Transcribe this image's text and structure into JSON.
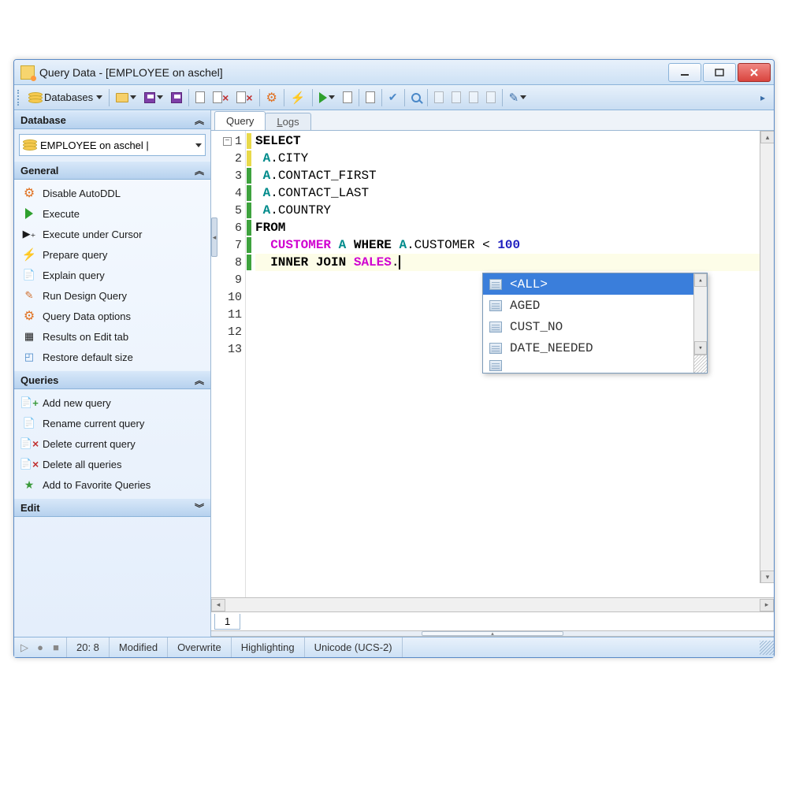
{
  "window": {
    "title": "Query Data - [EMPLOYEE on aschel]"
  },
  "toolbar": {
    "databases_label": "Databases"
  },
  "sidebar": {
    "panel_database": "Database",
    "db_selected": "EMPLOYEE on aschel |",
    "panel_general": "General",
    "general_items": [
      "Disable AutoDDL",
      "Execute",
      "Execute under Cursor",
      "Prepare query",
      "Explain query",
      "Run Design Query",
      "Query Data options",
      "Results on Edit tab",
      "Restore default size"
    ],
    "panel_queries": "Queries",
    "queries_items": [
      "Add new query",
      "Rename current query",
      "Delete current query",
      "Delete all queries",
      "Add to Favorite Queries"
    ],
    "panel_edit": "Edit"
  },
  "tabs": {
    "query": "Query",
    "logs_prefix": "L",
    "logs_rest": "ogs"
  },
  "code": {
    "lines": [
      {
        "n": 1,
        "mark": "yellow",
        "html": "<span class='kw'>SELECT</span>"
      },
      {
        "n": 2,
        "mark": "yellow",
        "html": " <span class='id-a'>A</span><span class='id-col'>.CITY</span>"
      },
      {
        "n": 3,
        "mark": "green",
        "html": " <span class='id-a'>A</span><span class='id-col'>.CONTACT_FIRST</span>"
      },
      {
        "n": 4,
        "mark": "green",
        "html": " <span class='id-a'>A</span><span class='id-col'>.CONTACT_LAST</span>"
      },
      {
        "n": 5,
        "mark": "green",
        "html": " <span class='id-a'>A</span><span class='id-col'>.COUNTRY</span>"
      },
      {
        "n": 6,
        "mark": "green",
        "html": "<span class='kw'>FROM</span>"
      },
      {
        "n": 7,
        "mark": "green",
        "html": "  <span class='tbl'>CUSTOMER</span> <span class='id-a'>A</span> <span class='kw'>WHERE</span> <span class='id-a'>A</span><span class='id-col'>.CUSTOMER</span> &lt; <span class='num'>100</span>"
      },
      {
        "n": 8,
        "mark": "green",
        "hl": true,
        "html": "  <span class='kw'>INNER</span> <span class='kw'>JOIN</span> <span class='tbl'>SALES</span><span class='id-col'>.</span><span class='cursor'></span>"
      },
      {
        "n": 9,
        "mark": "",
        "html": ""
      },
      {
        "n": 10,
        "mark": "",
        "html": ""
      },
      {
        "n": 11,
        "mark": "",
        "html": ""
      },
      {
        "n": 12,
        "mark": "",
        "html": ""
      },
      {
        "n": 13,
        "mark": "",
        "html": ""
      }
    ]
  },
  "autocomplete": {
    "items": [
      "<ALL>",
      "AGED",
      "CUST_NO",
      "DATE_NEEDED"
    ],
    "selected": 0
  },
  "bottom_tab": "1",
  "status": {
    "cursor": "20:   8",
    "modified": "Modified",
    "overwrite": "Overwrite",
    "highlighting": "Highlighting",
    "encoding": "Unicode (UCS-2)"
  }
}
